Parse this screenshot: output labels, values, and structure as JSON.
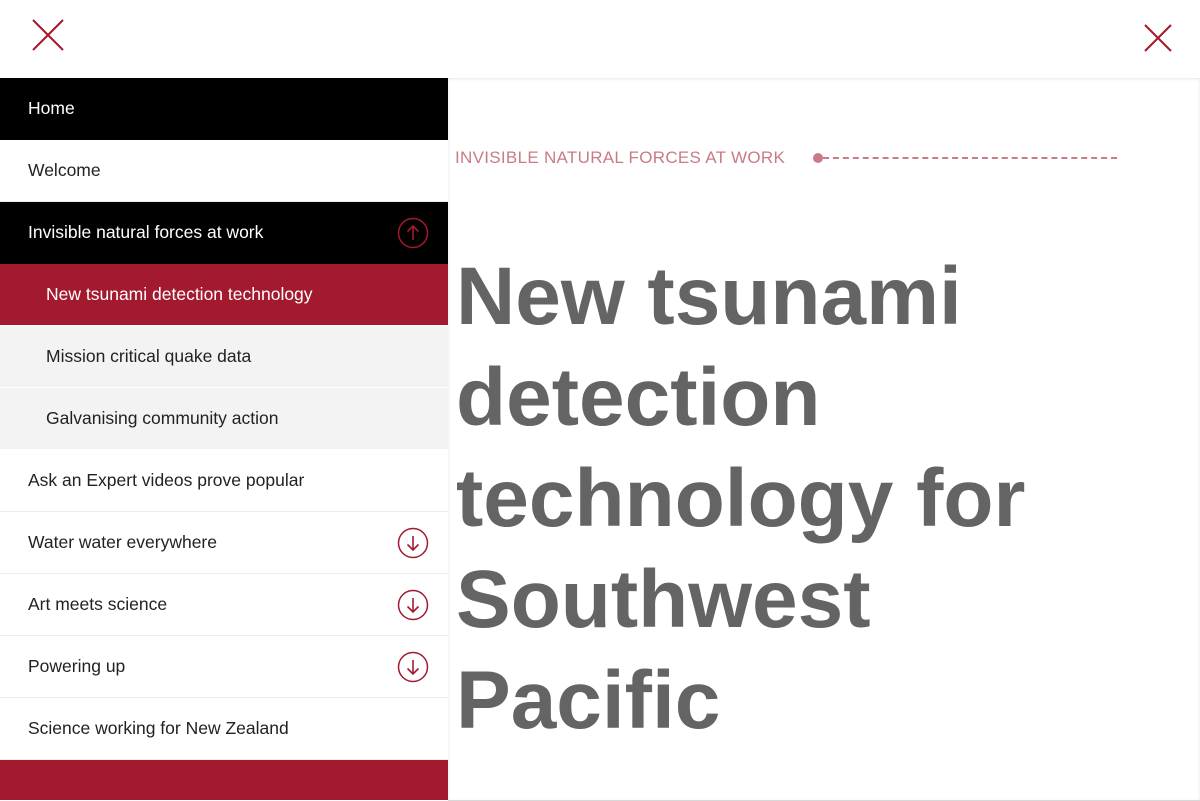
{
  "header": {
    "close_left_icon": "close-icon",
    "close_right_icon": "close-icon"
  },
  "colors": {
    "accent": "#a31a2f",
    "eyebrow": "#c97b86",
    "title": "#646464",
    "dark": "#000000",
    "sub_bg": "#f3f3f3"
  },
  "nav": {
    "items": [
      {
        "label": "Home"
      },
      {
        "label": "Welcome"
      },
      {
        "label": "Invisible natural forces at work",
        "toggle_icon": "arrow-up-circle-icon"
      },
      {
        "label": "New tsunami detection technology"
      },
      {
        "label": "Mission critical quake data"
      },
      {
        "label": "Galvanising community action"
      },
      {
        "label": "Ask an Expert videos prove popular"
      },
      {
        "label": "Water water everywhere",
        "toggle_icon": "arrow-down-circle-icon"
      },
      {
        "label": "Art meets science",
        "toggle_icon": "arrow-down-circle-icon"
      },
      {
        "label": "Powering up",
        "toggle_icon": "arrow-down-circle-icon"
      },
      {
        "label": "Science working for New Zealand"
      }
    ]
  },
  "main": {
    "eyebrow": "INVISIBLE NATURAL FORCES AT WORK",
    "title_lines": [
      "New tsunami",
      "detection",
      "technology for",
      "Southwest",
      "Pacific"
    ]
  }
}
